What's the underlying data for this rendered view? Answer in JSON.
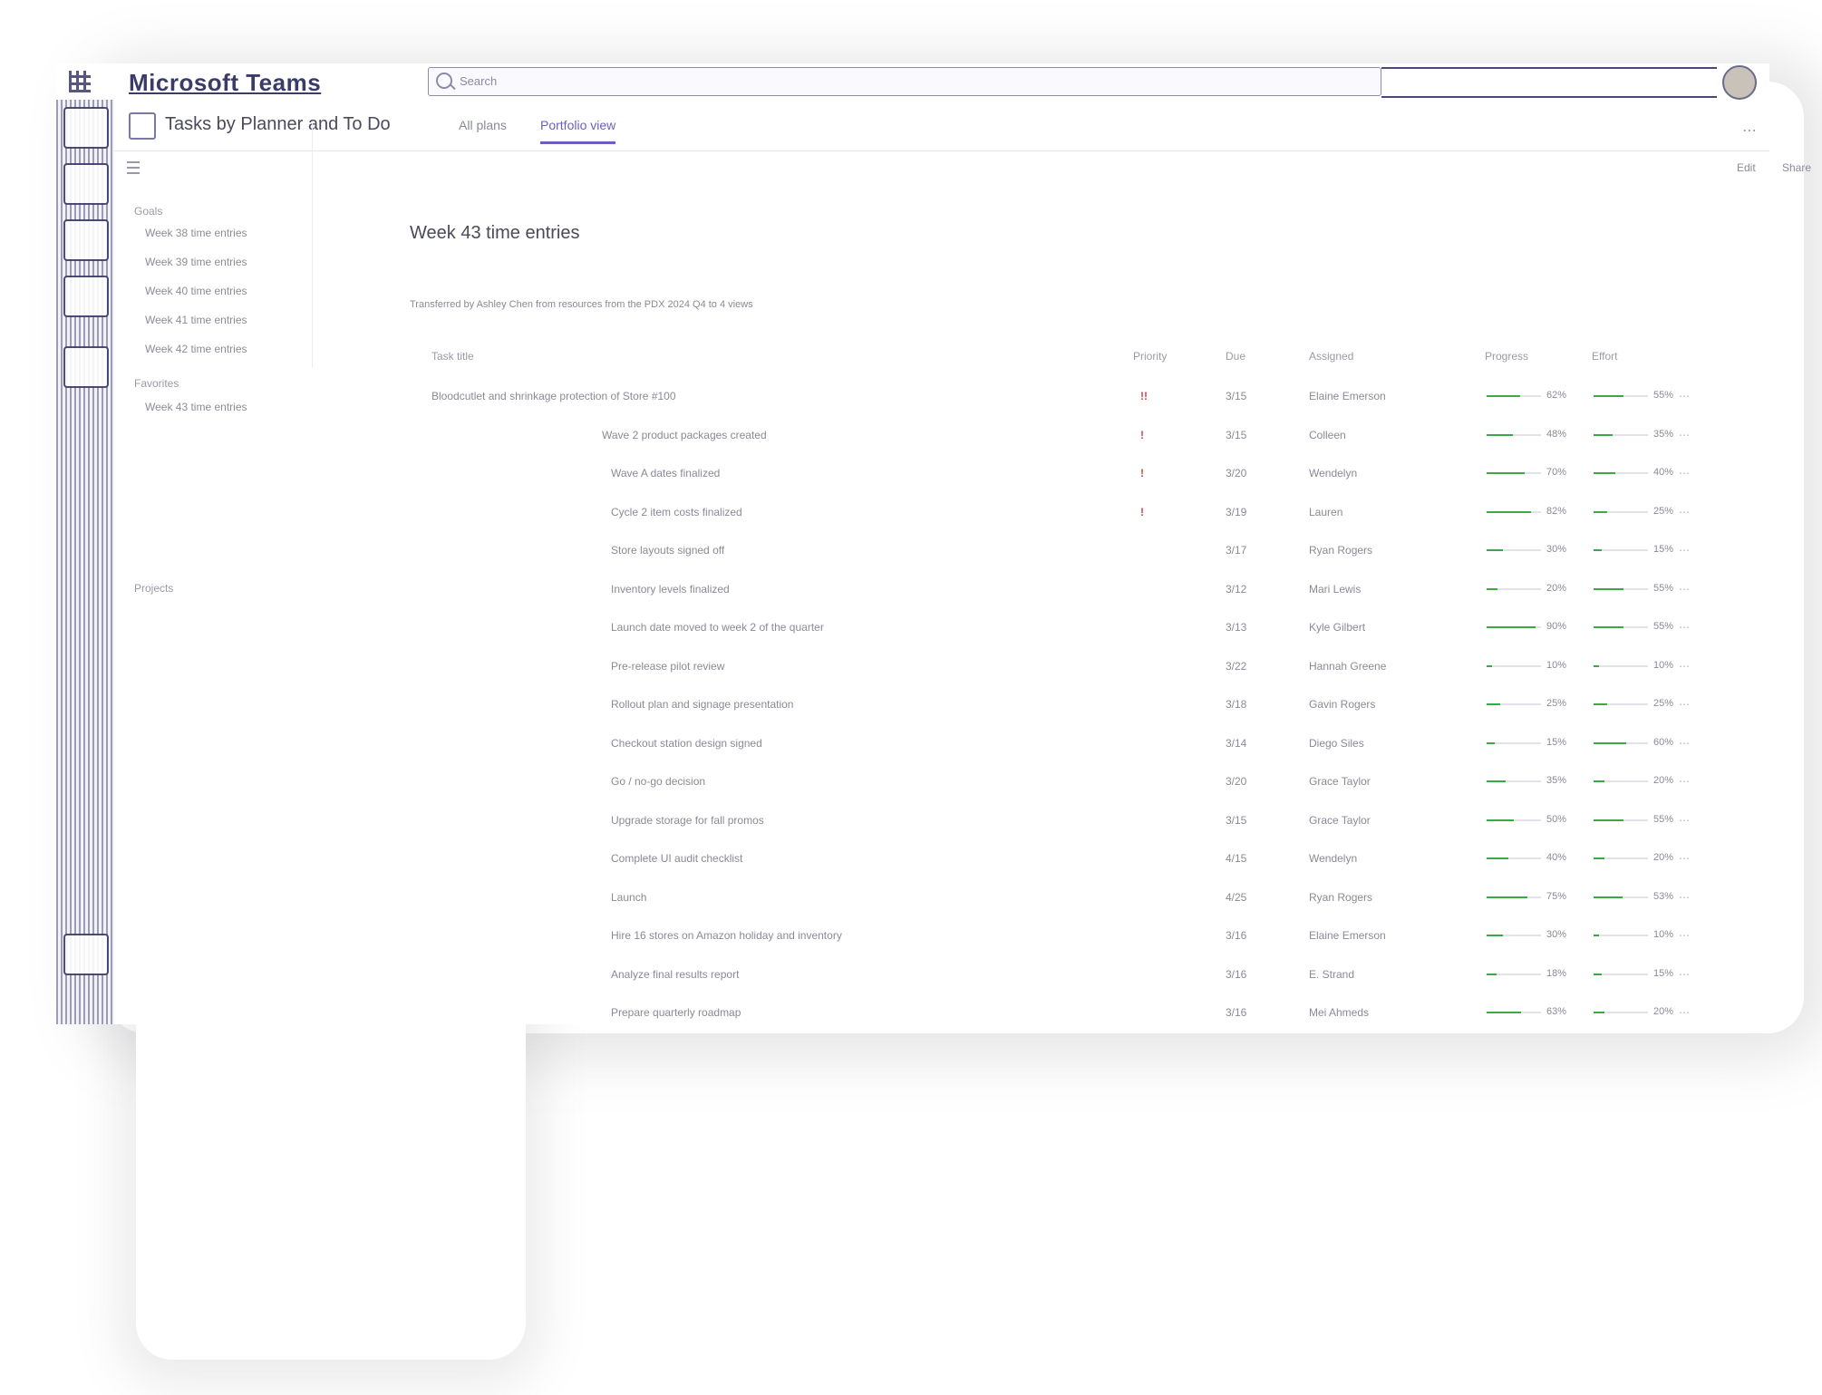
{
  "titlebar": {
    "app_title": "Microsoft Teams",
    "search_placeholder": "Search"
  },
  "header": {
    "plan_title": "Tasks by Planner and To Do",
    "tabs": [
      {
        "label": "All plans"
      },
      {
        "label": "Portfolio view"
      }
    ]
  },
  "toolbar": {
    "left_btn": "Edit",
    "right_btn": "Share"
  },
  "nav": {
    "heading1": "Goals",
    "items1": [
      "Week 38 time entries",
      "Week 39 time entries",
      "Week 40 time entries",
      "Week 41 time entries",
      "Week 42 time entries"
    ],
    "heading2": "Favorites",
    "items2": [
      "Week 43 time entries"
    ],
    "heading3": "Projects"
  },
  "main": {
    "title": "Week 43 time entries",
    "subtitle": "Transferred by Ashley Chen from resources from the PDX 2024 Q4 to 4 views",
    "columns": {
      "task": "Task title",
      "priority": "Priority",
      "due": "Due",
      "assigned": "Assigned",
      "progress": "Progress",
      "effort": "Effort"
    },
    "rows": [
      {
        "title": "Bloodcutlet and shrinkage protection of Store #100",
        "priority": "!!",
        "due": "3/15",
        "assigned": "Elaine Emerson",
        "progress": 62,
        "effort": 55
      },
      {
        "title": "Wave 2 product packages created",
        "priority": "!",
        "due": "3/15",
        "assigned": "Colleen",
        "progress": 48,
        "effort": 35
      },
      {
        "title": "Wave A dates finalized",
        "priority": "!",
        "due": "3/20",
        "assigned": "Wendelyn",
        "progress": 70,
        "effort": 40
      },
      {
        "title": "Cycle 2 item costs finalized",
        "priority": "!",
        "due": "3/19",
        "assigned": "Lauren",
        "progress": 82,
        "effort": 25
      },
      {
        "title": "Store layouts signed off",
        "priority": "",
        "due": "3/17",
        "assigned": "Ryan Rogers",
        "progress": 30,
        "effort": 15
      },
      {
        "title": "Inventory levels finalized",
        "priority": "",
        "due": "3/12",
        "assigned": "Mari Lewis",
        "progress": 20,
        "effort": 55
      },
      {
        "title": "Launch date moved to week 2 of the quarter",
        "priority": "",
        "due": "3/13",
        "assigned": "Kyle Gilbert",
        "progress": 90,
        "effort": 55
      },
      {
        "title": "Pre-release pilot review",
        "priority": "",
        "due": "3/22",
        "assigned": "Hannah Greene",
        "progress": 10,
        "effort": 10
      },
      {
        "title": "Rollout plan and signage presentation",
        "priority": "",
        "due": "3/18",
        "assigned": "Gavin Rogers",
        "progress": 25,
        "effort": 25
      },
      {
        "title": "Checkout station design signed",
        "priority": "",
        "due": "3/14",
        "assigned": "Diego Siles",
        "progress": 15,
        "effort": 60
      },
      {
        "title": "Go / no-go decision",
        "priority": "",
        "due": "3/20",
        "assigned": "Grace Taylor",
        "progress": 35,
        "effort": 20
      },
      {
        "title": "Upgrade storage for fall promos",
        "priority": "",
        "due": "3/15",
        "assigned": "Grace Taylor",
        "progress": 50,
        "effort": 55
      },
      {
        "title": "Complete UI audit checklist",
        "priority": "",
        "due": "4/15",
        "assigned": "Wendelyn",
        "progress": 40,
        "effort": 20
      },
      {
        "title": "Launch",
        "priority": "",
        "due": "4/25",
        "assigned": "Ryan Rogers",
        "progress": 75,
        "effort": 53
      },
      {
        "title": "Hire 16 stores on Amazon holiday and inventory",
        "priority": "",
        "due": "3/16",
        "assigned": "Elaine Emerson",
        "progress": 30,
        "effort": 10
      },
      {
        "title": "Analyze final results report",
        "priority": "",
        "due": "3/16",
        "assigned": "E. Strand",
        "progress": 18,
        "effort": 15
      },
      {
        "title": "Prepare quarterly roadmap",
        "priority": "",
        "due": "3/16",
        "assigned": "Mei Ahmeds",
        "progress": 63,
        "effort": 20
      }
    ]
  },
  "colors": {
    "accent": "#6a5fc0",
    "progress_fill": "#3aa845",
    "priority": "#d04a4a"
  }
}
